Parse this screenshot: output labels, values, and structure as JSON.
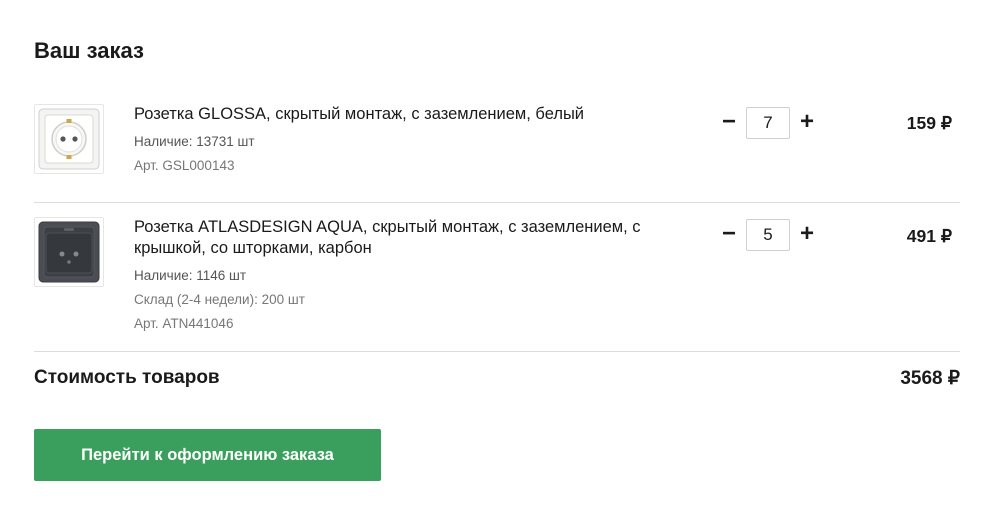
{
  "title": "Ваш заказ",
  "items": [
    {
      "name": "Розетка GLOSSA, скрытый монтаж, с заземлением, белый",
      "availability": "Наличие: 13731 шт",
      "warehouse": "",
      "sku": "Арт. GSL000143",
      "quantity": "7",
      "price": "159 ₽",
      "image_icon": "white-socket-icon"
    },
    {
      "name": "Розетка ATLASDESIGN AQUA, скрытый монтаж, с заземлением, с крышкой, со шторками, карбон",
      "availability": "Наличие: 1146 шт",
      "warehouse": "Склад (2-4 недели): 200 шт",
      "sku": "Арт. ATN441046",
      "quantity": "5",
      "price": "491 ₽",
      "image_icon": "carbon-socket-icon"
    }
  ],
  "controls": {
    "minus": "−",
    "plus": "+"
  },
  "total": {
    "label": "Стоимость товаров",
    "value": "3568 ₽"
  },
  "checkout_label": "Перейти к оформлению заказа",
  "colors": {
    "button": "#3a9e5c",
    "divider": "#dcdcdc"
  }
}
